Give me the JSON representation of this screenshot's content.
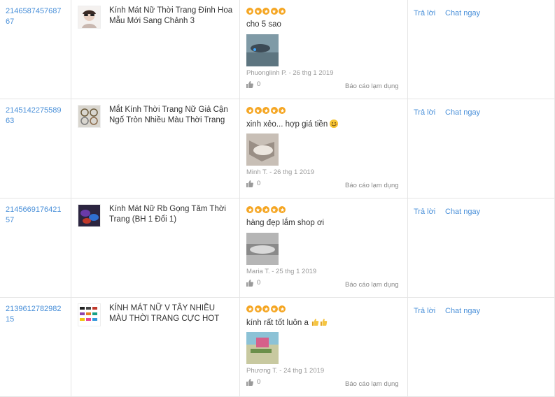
{
  "reviews": [
    {
      "order_id": "214658745768767",
      "product": "Kính Mát Nữ Thời Trang Đính Hoa Mẫu Mới Sang Chảnh 3",
      "rating": 5,
      "comment": "cho 5 sao",
      "comment_suffix": "",
      "author_date": "Phuonglinh P. - 26 thg 1 2019",
      "likes": "0",
      "report": "Báo cáo lạm dụng",
      "reply": "Trả lời",
      "chat": "Chat ngay"
    },
    {
      "order_id": "214514227558963",
      "product": "Mắt Kính Thời Trang Nữ Giả Cận Ngố Tròn Nhiều Màu Thời Trang",
      "rating": 5,
      "comment": "xinh xẻo... hợp giá tiền",
      "comment_suffix": "smile-emoji",
      "author_date": "Minh T. - 26 thg 1 2019",
      "likes": "0",
      "report": "Báo cáo lạm dụng",
      "reply": "Trả lời",
      "chat": "Chat ngay"
    },
    {
      "order_id": "214566917642157",
      "product": "Kính Mát Nữ Rb Gọng Tăm Thời Trang (BH 1 Đổi 1)",
      "rating": 5,
      "comment": "hàng đẹp lắm shop ơi",
      "comment_suffix": "",
      "author_date": "Maria T. - 25 thg 1 2019",
      "likes": "0",
      "report": "Báo cáo lạm dụng",
      "reply": "Trả lời",
      "chat": "Chat ngay"
    },
    {
      "order_id": "213961278298215",
      "product": "KÍNH MÁT NỮ V TÂY NHIỀU MÀU THỜI TRANG CỰC HOT",
      "rating": 5,
      "comment": "kính rất tốt luôn a",
      "comment_suffix": "thumbs-up-emoji",
      "author_date": "Phương T. - 24 thg 1 2019",
      "likes": "0",
      "report": "Báo cáo lạm dụng",
      "reply": "Trả lời",
      "chat": "Chat ngay"
    }
  ],
  "order_id_lines": [
    [
      "2146587457687",
      "67"
    ],
    [
      "2145142275589",
      "63"
    ],
    [
      "2145669176421",
      "57"
    ],
    [
      "2139612782982",
      "15"
    ]
  ],
  "colors": {
    "link": "#4a90d9",
    "star": "#f5a623",
    "border": "#e5e5e5",
    "meta": "#999999"
  },
  "icons": {
    "star": "star-icon",
    "like": "thumbs-up-icon"
  }
}
